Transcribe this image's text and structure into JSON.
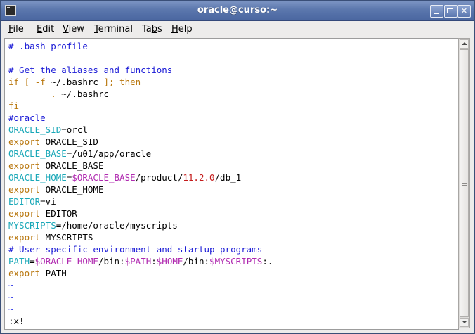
{
  "window": {
    "title": "oracle@curso:~",
    "icon": "terminal-icon",
    "buttons": {
      "minimize": "minimize-icon",
      "maximize": "maximize-icon",
      "close": "✕"
    }
  },
  "menu": {
    "items": [
      {
        "pre": "",
        "u": "F",
        "post": "ile"
      },
      {
        "pre": "",
        "u": "E",
        "post": "dit"
      },
      {
        "pre": "",
        "u": "V",
        "post": "iew"
      },
      {
        "pre": "",
        "u": "T",
        "post": "erminal"
      },
      {
        "pre": "Ta",
        "u": "b",
        "post": "s"
      },
      {
        "pre": "",
        "u": "H",
        "post": "elp"
      }
    ]
  },
  "terminal": {
    "colors": {
      "comment": "#1b1bd6",
      "keyword": "#b8760c",
      "variable": "#1aa8b8",
      "reference": "#b02ab0",
      "number": "#c41b1b",
      "tilde": "#2d35e6"
    },
    "lines": [
      [
        {
          "t": "# .bash_profile",
          "c": "comment"
        }
      ],
      [],
      [
        {
          "t": "# Get the aliases and functions",
          "c": "comment"
        }
      ],
      [
        {
          "t": "if [ -f ",
          "c": "keyword"
        },
        {
          "t": "~/.bashrc",
          "c": ""
        },
        {
          "t": " ]; then",
          "c": "keyword"
        }
      ],
      [
        {
          "t": "        ",
          "c": ""
        },
        {
          "t": ".",
          "c": "keyword"
        },
        {
          "t": " ~/.bashrc",
          "c": ""
        }
      ],
      [
        {
          "t": "fi",
          "c": "keyword"
        }
      ],
      [
        {
          "t": "#oracle",
          "c": "comment"
        }
      ],
      [
        {
          "t": "ORACLE_SID",
          "c": "var"
        },
        {
          "t": "=orcl",
          "c": ""
        }
      ],
      [
        {
          "t": "export",
          "c": "keyword"
        },
        {
          "t": " ORACLE_SID",
          "c": ""
        }
      ],
      [
        {
          "t": "ORACLE_BASE",
          "c": "var"
        },
        {
          "t": "=/u01/app/oracle",
          "c": ""
        }
      ],
      [
        {
          "t": "export",
          "c": "keyword"
        },
        {
          "t": " ORACLE_BASE",
          "c": ""
        }
      ],
      [
        {
          "t": "ORACLE_HOME",
          "c": "var"
        },
        {
          "t": "=",
          "c": ""
        },
        {
          "t": "$ORACLE_BASE",
          "c": "ref"
        },
        {
          "t": "/product/",
          "c": ""
        },
        {
          "t": "11.2.0",
          "c": "num"
        },
        {
          "t": "/db_1",
          "c": ""
        }
      ],
      [
        {
          "t": "export",
          "c": "keyword"
        },
        {
          "t": " ORACLE_HOME",
          "c": ""
        }
      ],
      [
        {
          "t": "EDITOR",
          "c": "var"
        },
        {
          "t": "=vi",
          "c": ""
        }
      ],
      [
        {
          "t": "export",
          "c": "keyword"
        },
        {
          "t": " EDITOR",
          "c": ""
        }
      ],
      [
        {
          "t": "MYSCRIPTS",
          "c": "var"
        },
        {
          "t": "=/home/oracle/myscripts",
          "c": ""
        }
      ],
      [
        {
          "t": "export",
          "c": "keyword"
        },
        {
          "t": " MYSCRIPTS",
          "c": ""
        }
      ],
      [
        {
          "t": "# User specific environment and startup programs",
          "c": "comment"
        }
      ],
      [
        {
          "t": "PATH",
          "c": "var"
        },
        {
          "t": "=",
          "c": ""
        },
        {
          "t": "$ORACLE_HOME",
          "c": "ref"
        },
        {
          "t": "/bin:",
          "c": ""
        },
        {
          "t": "$PATH",
          "c": "ref"
        },
        {
          "t": ":",
          "c": ""
        },
        {
          "t": "$HOME",
          "c": "ref"
        },
        {
          "t": "/bin:",
          "c": ""
        },
        {
          "t": "$MYSCRIPTS",
          "c": "ref"
        },
        {
          "t": ":.",
          "c": ""
        }
      ],
      [
        {
          "t": "export",
          "c": "keyword"
        },
        {
          "t": " PATH",
          "c": ""
        }
      ],
      [
        {
          "t": "~",
          "c": "tilde"
        }
      ],
      [
        {
          "t": "~",
          "c": "tilde"
        }
      ],
      [
        {
          "t": "~",
          "c": "tilde"
        }
      ],
      [
        {
          "t": ":x!",
          "c": ""
        }
      ]
    ]
  }
}
